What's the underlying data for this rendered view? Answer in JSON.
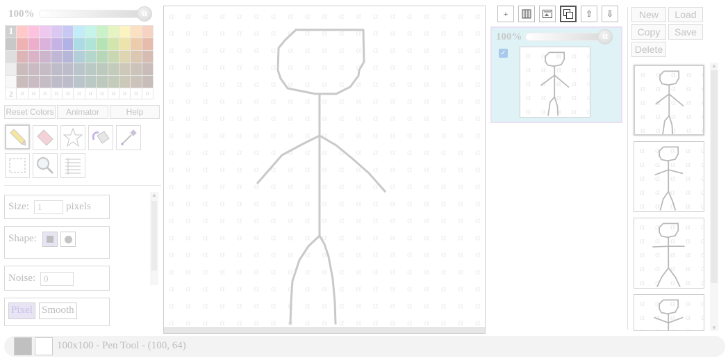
{
  "left_panel": {
    "opacity": {
      "value_label": "100%",
      "knob_glyph": "α"
    },
    "palette": {
      "row1_label": "1",
      "row2_label": "2",
      "alpha_glyph": "α",
      "row_colors": [
        [
          "#ffc9c9",
          "#ffc2de",
          "#efc8ef",
          "#dbc8f2",
          "#c8c8f4",
          "#c2ecf7",
          "#c6f3ea",
          "#c9f2c9",
          "#e6f4c2",
          "#fbf4c0",
          "#fbe0c2",
          "#f6d2c2"
        ],
        [
          "#efb2b2",
          "#edaecc",
          "#dbb2db",
          "#c6b2e4",
          "#b2b2e6",
          "#acdbe6",
          "#b0e4d8",
          "#b4e4b4",
          "#d2e6ac",
          "#ece4aa",
          "#ecccac",
          "#e6bcac"
        ],
        [
          "#dcb6b6",
          "#dab4c6",
          "#cdb6cd",
          "#c0b6d6",
          "#b6b6d8",
          "#b2ced8",
          "#b4d6cc",
          "#b8d6b8",
          "#c9d8b2",
          "#ddd6b0",
          "#dcc8b2",
          "#d6bcb2"
        ],
        [
          "#cbbcbc",
          "#cabbc2",
          "#c5bcc5",
          "#bfbcc9",
          "#bcbccb",
          "#bac5cb",
          "#bbc9c4",
          "#bdc9bd",
          "#c3cbba",
          "#ccc9b9",
          "#ccc3ba",
          "#c9bdba"
        ]
      ],
      "gray_column": [
        "#d0d0d0",
        "#c8c8c8",
        "#dedede",
        "#eeeeee",
        "#f8f8f8"
      ]
    },
    "buttons": {
      "reset_colors": "Reset Colors",
      "animator": "Animator",
      "help": "Help"
    },
    "tools": [
      "pencil-tool",
      "eraser-tool",
      "star-tool",
      "fill-bucket-tool",
      "eyedropper-tool",
      "rect-select-tool",
      "zoom-tool",
      "list-tool"
    ],
    "options": {
      "size_label": "Size:",
      "size_value": "1",
      "size_unit": "pixels",
      "shape_label": "Shape:",
      "noise_label": "Noise:",
      "noise_value": "0",
      "pixel_label": "Pixel",
      "smooth_label": "Smooth"
    }
  },
  "canvas": {
    "grid_glyph": "α"
  },
  "layers": {
    "buttons": [
      "+",
      "▥",
      "⇱",
      "⧉",
      "⇧",
      "⇩"
    ],
    "layer1": {
      "opacity_label": "100%",
      "knob_glyph": "α",
      "visible": true
    }
  },
  "frames_panel": {
    "buttons": {
      "new": "New",
      "load": "Load",
      "copy": "Copy",
      "save": "Save",
      "delete": "Delete"
    }
  },
  "status_bar": {
    "text": "100x100 - Pen Tool - (100, 64)",
    "primary_color": "#c0c0c0",
    "secondary_color": "#ffffff"
  }
}
